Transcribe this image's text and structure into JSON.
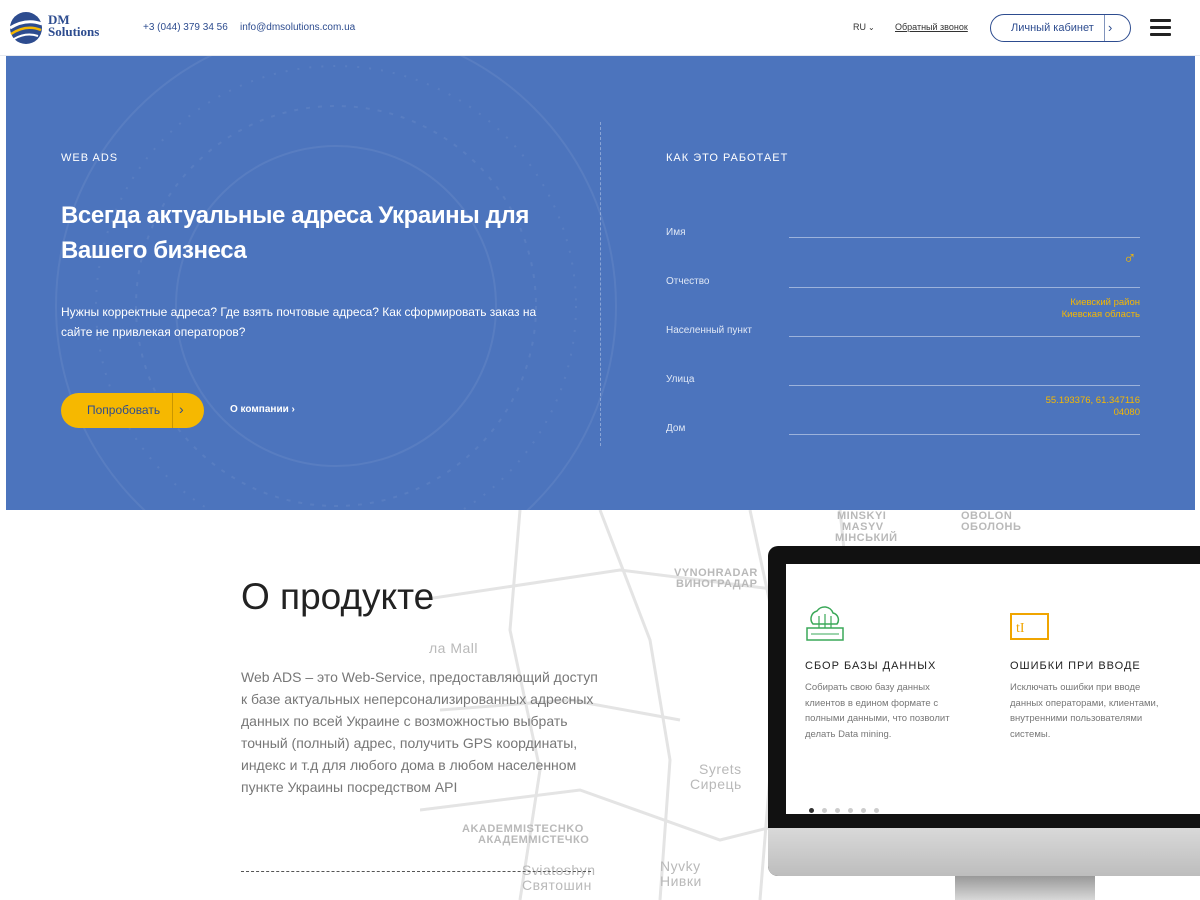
{
  "brand": {
    "line1": "DM",
    "line2": "Solutions"
  },
  "header": {
    "phone": "+3 (044) 379 34 56",
    "email": "info@dmsolutions.com.ua",
    "lang": "RU",
    "callback": "Обратный звонок",
    "cabinet": "Личный кабинет"
  },
  "hero": {
    "eyebrow": "WEB ADS",
    "title": "Всегда актуальные адреса Украины для Вашего бизнеса",
    "desc": "Нужны корректные адреса? Где взять почтовые адреса? Как сформировать заказ на сайте не привлекая операторов?",
    "try_button": "Попробовать",
    "about_link": "О компании"
  },
  "how": {
    "title": "КАК ЭТО РАБОТАЕТ",
    "fields": [
      "Имя",
      "Отчество",
      "Населенный пункт",
      "Улица",
      "Дом"
    ],
    "hint_region_1": "Киевский район",
    "hint_region_2": "Киевская область",
    "hint_gps": "55.193376, 61.347116",
    "hint_zip": "04080"
  },
  "product": {
    "title": "О продукте",
    "desc": "Web ADS – это Web-Service, предоставляющий доступ к базе актуальных неперсонализированных адресных данных по всей Украине с возможностью выбрать точный (полный) адрес, получить GPS координаты, индекс и т.д для любого дома в любом населенном пункте Украины посредством API"
  },
  "map_labels": {
    "minsky": "MINSKYI",
    "masyv": "MASYV",
    "minskyi_ua": "МІНСЬКИЙ",
    "obolon_en": "OBOLON",
    "obolon_ua": "ОБОЛОНЬ",
    "vynohradar_en": "VYNOHRADAR",
    "vynohradar_ua": "ВИНОГРАДАР",
    "mall": "ла Mall",
    "syrets_en": "Syrets",
    "syrets_ua": "Сирець",
    "akadem_en": "AKADEMMISTECHKO",
    "akadem_ua": "АКАДЕММІСТЕЧКО",
    "sviatoshyn_en": "Sviatoshyn",
    "sviatoshyn_ua": "Святошин",
    "nyvky_en": "Nyvky",
    "nyvky_ua": "Нивки"
  },
  "features": [
    {
      "title": "СБОР БАЗЫ ДАННЫХ",
      "text": "Собирать свою базу данных клиентов в едином формате с полными данными, что позволит делать Data mining.",
      "icon": "database-cloud-icon"
    },
    {
      "title": "ОШИБКИ ПРИ ВВОДЕ",
      "text": "Исключать ошибки при вводе данных операторами, клиентами, внутренними пользователями системы.",
      "icon": "text-cursor-icon"
    }
  ],
  "colors": {
    "hero": "#4c74bd",
    "accent": "#f6b800",
    "brand": "#2d4c8f"
  }
}
